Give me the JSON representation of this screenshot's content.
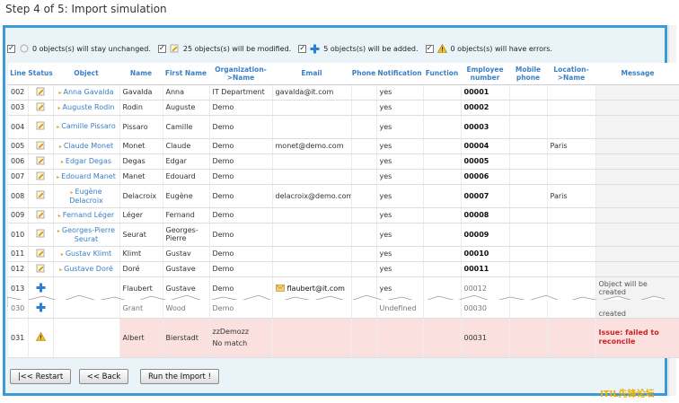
{
  "step_title": "Step 4 of 5: Import simulation",
  "summary": [
    {
      "checked": true,
      "icon": "unchanged-circle-icon",
      "text": "0 objects(s) will stay unchanged."
    },
    {
      "checked": true,
      "icon": "modified-pencil-icon",
      "text": "25 objects(s) will be modified."
    },
    {
      "checked": true,
      "icon": "added-plus-icon",
      "text": "5 objects(s) will be added."
    },
    {
      "checked": true,
      "icon": "error-warning-icon",
      "text": "0 objects(s) will have errors."
    }
  ],
  "columns": [
    "Line",
    "Status",
    "Object",
    "Name",
    "First Name",
    "Organization->Name",
    "Email",
    "Phone",
    "Notification",
    "Function",
    "Employee number",
    "Mobile phone",
    "Location->Name",
    "Message"
  ],
  "rows": [
    {
      "line": "002",
      "status": "modified",
      "object": "Anna Gavalda",
      "name": "Gavalda",
      "first": "Anna",
      "org": "IT Department",
      "email": "gavalda@it.com",
      "notif": "yes",
      "emp": "00001",
      "loc": "",
      "msg": ""
    },
    {
      "line": "003",
      "status": "modified",
      "object": "Auguste Rodin",
      "name": "Rodin",
      "first": "Auguste",
      "org": "Demo",
      "email": "",
      "notif": "yes",
      "emp": "00002",
      "loc": "",
      "msg": ""
    },
    {
      "line": "004",
      "status": "modified",
      "object": "Camille Pissaro",
      "name": "Pissaro",
      "first": "Camille",
      "org": "Demo",
      "email": "",
      "notif": "yes",
      "emp": "00003",
      "loc": "",
      "msg": ""
    },
    {
      "line": "005",
      "status": "modified",
      "object": "Claude Monet",
      "name": "Monet",
      "first": "Claude",
      "org": "Demo",
      "email": "monet@demo.com",
      "notif": "yes",
      "emp": "00004",
      "loc": "Paris",
      "msg": ""
    },
    {
      "line": "006",
      "status": "modified",
      "object": "Edgar Degas",
      "name": "Degas",
      "first": "Edgar",
      "org": "Demo",
      "email": "",
      "notif": "yes",
      "emp": "00005",
      "loc": "",
      "msg": ""
    },
    {
      "line": "007",
      "status": "modified",
      "object": "Edouard Manet",
      "name": "Manet",
      "first": "Edouard",
      "org": "Demo",
      "email": "",
      "notif": "yes",
      "emp": "00006",
      "loc": "",
      "msg": ""
    },
    {
      "line": "008",
      "status": "modified",
      "object": "Eugène Delacroix",
      "name": "Delacroix",
      "first": "Eugène",
      "org": "Demo",
      "email": "delacroix@demo.com",
      "notif": "yes",
      "emp": "00007",
      "loc": "Paris",
      "msg": ""
    },
    {
      "line": "009",
      "status": "modified",
      "object": "Fernand Léger",
      "name": "Léger",
      "first": "Fernand",
      "org": "Demo",
      "email": "",
      "notif": "yes",
      "emp": "00008",
      "loc": "",
      "msg": ""
    },
    {
      "line": "010",
      "status": "modified",
      "object": "Georges-Pierre Seurat",
      "name": "Seurat",
      "first": "Georges-Pierre",
      "org": "Demo",
      "email": "",
      "notif": "yes",
      "emp": "00009",
      "loc": "",
      "msg": ""
    },
    {
      "line": "011",
      "status": "modified",
      "object": "Gustav Klimt",
      "name": "Klimt",
      "first": "Gustav",
      "org": "Demo",
      "email": "",
      "notif": "yes",
      "emp": "00010",
      "loc": "",
      "msg": ""
    },
    {
      "line": "012",
      "status": "modified",
      "object": "Gustave Doré",
      "name": "Doré",
      "first": "Gustave",
      "org": "Demo",
      "email": "",
      "notif": "yes",
      "emp": "00011",
      "loc": "",
      "msg": ""
    },
    {
      "line": "013",
      "status": "added",
      "object": "",
      "name": "Flaubert",
      "first": "Gustave",
      "org": "Demo",
      "email": "flaubert@it.com",
      "notif": "yes",
      "emp": "00012",
      "loc": "",
      "msg": "Object will be created"
    }
  ],
  "torn_rows": [
    {
      "line": "030",
      "status": "added",
      "name": "Grant",
      "first": "Wood",
      "org": "Demo",
      "notif": "Undefined",
      "emp": "00030",
      "msg": "created"
    },
    {
      "line": "031",
      "status": "error",
      "name": "Albert",
      "first": "Bierstadt",
      "org_line1": "zzDemozz",
      "org_line2": "No match",
      "emp": "00031",
      "msg": "Issue: failed to reconcile"
    }
  ],
  "buttons": {
    "restart": "|<< Restart",
    "back": "<< Back",
    "run": "Run the Import !"
  },
  "watermark": "ITIL先锋论坛",
  "colors": {
    "frame_border": "#3c9ad6",
    "header_text": "#3b7fc4",
    "error_row": "#fbe0e0",
    "error_text": "#d02020"
  }
}
